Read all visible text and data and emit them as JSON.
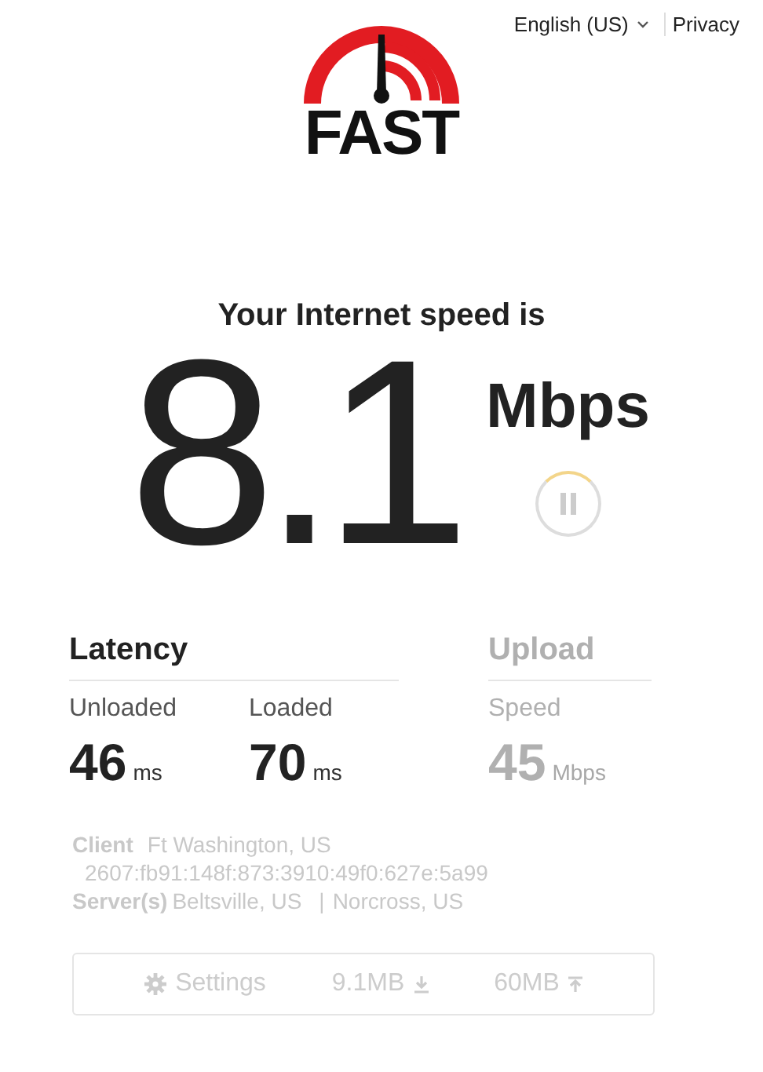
{
  "header": {
    "language": "English (US)",
    "privacy": "Privacy"
  },
  "logo": {
    "text": "FAST"
  },
  "speed": {
    "title": "Your Internet speed is",
    "value": "8.1",
    "unit": "Mbps",
    "paused": true
  },
  "sections": [
    {
      "title": "Latency",
      "disabled": false,
      "metrics": [
        {
          "label": "Unloaded",
          "value": "46",
          "unit": "ms"
        },
        {
          "label": "Loaded",
          "value": "70",
          "unit": "ms"
        }
      ]
    },
    {
      "title": "Upload",
      "disabled": true,
      "metrics": [
        {
          "label": "Speed",
          "value": "45",
          "unit": "Mbps"
        }
      ]
    }
  ],
  "info": {
    "client_label": "Client",
    "client_location": "Ft Washington, US",
    "client_ip": "2607:fb91:148f:873:3910:49f0:627e:5a99",
    "servers_label": "Server(s)",
    "servers": [
      "Beltsville, US",
      "Norcross, US"
    ],
    "separator": "|"
  },
  "footer": {
    "settings": "Settings",
    "download_size": "9.1MB",
    "upload_size": "60MB"
  }
}
